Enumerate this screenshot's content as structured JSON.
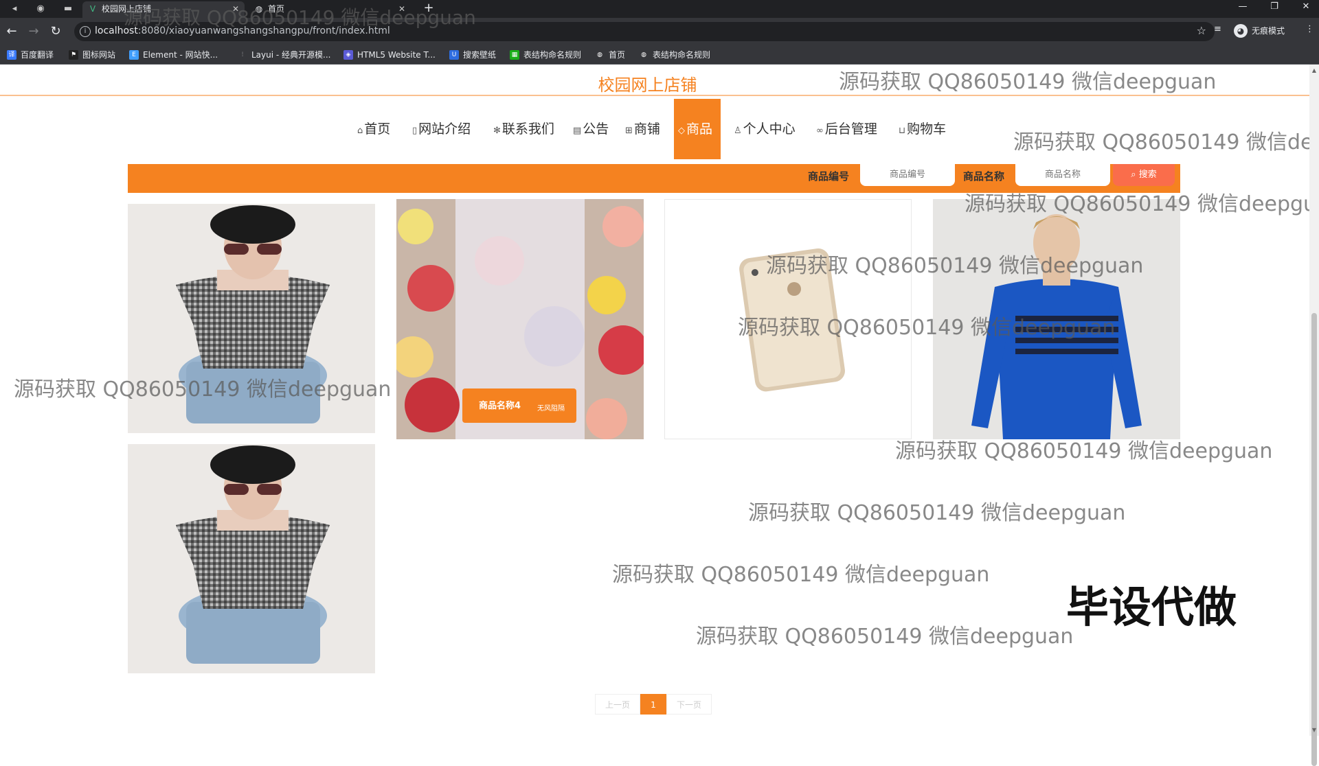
{
  "browser": {
    "tabs": [
      {
        "title": "校园网上店铺",
        "icon": "vue-logo-icon"
      },
      {
        "title": "首页",
        "icon": "globe-icon"
      }
    ],
    "url_host": "localhost",
    "url_rest": ":8080/xiaoyuanwangshangshangpu/front/index.html",
    "incognito_label": "无痕模式",
    "bookmarks": [
      "百度翻译",
      "图标网站",
      "Element - 网站快...",
      "Layui - 经典开源模...",
      "HTML5 Website T...",
      "搜索壁纸",
      "表结构命名规则",
      "首页",
      "表结构命名规则"
    ]
  },
  "site": {
    "title": "校园网上店铺",
    "nav": [
      {
        "label": "首页",
        "icon": "home-icon"
      },
      {
        "label": "网站介绍",
        "icon": "doc-icon"
      },
      {
        "label": "联系我们",
        "icon": "snowflake-icon"
      },
      {
        "label": "公告",
        "icon": "notice-icon"
      },
      {
        "label": "商铺",
        "icon": "grid-icon"
      },
      {
        "label": "商品",
        "icon": "tag-icon",
        "active": true
      },
      {
        "label": "个人中心",
        "icon": "user-icon"
      },
      {
        "label": "后台管理",
        "icon": "link-icon"
      },
      {
        "label": "购物车",
        "icon": "cart-icon"
      }
    ]
  },
  "search": {
    "label1": "商品编号",
    "placeholder1": "商品编号",
    "label2": "商品名称",
    "placeholder2": "商品名称",
    "button": "搜索"
  },
  "products": [
    {
      "image": "woman-gingham-top-photo"
    },
    {
      "image": "flowers-banner-photo",
      "overlay_title": "商品名称4",
      "overlay_sub": "无风阻隔"
    },
    {
      "image": "iphone-gold-photo"
    },
    {
      "image": "man-blue-sweater-photo"
    },
    {
      "image": "woman-gingham-top-photo"
    }
  ],
  "pagination": {
    "prev": "上一页",
    "current": "1",
    "next": "下一页"
  },
  "watermark_text": "源码获取 QQ86050149 微信deepguan",
  "stamp_text": "毕设代做",
  "colors": {
    "accent": "#f58220",
    "search_button": "#fa6d4b"
  }
}
